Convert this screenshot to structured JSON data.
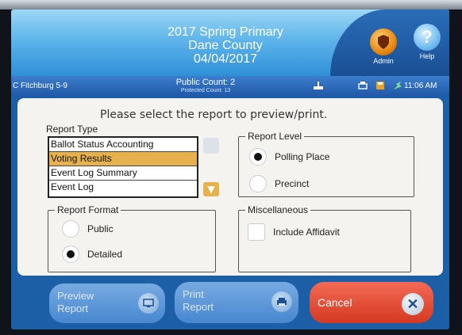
{
  "header": {
    "title_line1": "2017 Spring Primary",
    "title_line2": "Dane County",
    "title_line3": "04/04/2017",
    "admin_label": "Admin",
    "help_label": "Help"
  },
  "statusbar": {
    "precinct": "C Fitchburg 5-9",
    "public_count": "Public Count: 2",
    "protected_count": "Protected Count: 13",
    "time": "11:06 AM"
  },
  "instructions": "Please select the report to preview/print.",
  "report_type": {
    "label": "Report Type",
    "items": [
      "Ballot Status Accounting",
      "Voting Results",
      "Event Log Summary",
      "Event Log"
    ],
    "selected": "Voting Results"
  },
  "report_level": {
    "legend": "Report Level",
    "options": [
      "Polling Place",
      "Precinct"
    ],
    "selected": "Polling Place"
  },
  "report_format": {
    "legend": "Report Format",
    "options": [
      "Public",
      "Detailed"
    ],
    "selected": "Detailed"
  },
  "misc": {
    "legend": "Miscellaneous",
    "include_affidavit": "Include Affidavit"
  },
  "buttons": {
    "preview_line1": "Preview",
    "preview_line2": "Report",
    "print_line1": "Print",
    "print_line2": "Report",
    "cancel": "Cancel"
  },
  "colors": {
    "selected_row": "#e7b24d",
    "cancel": "#d63922",
    "accent_blue": "#1d5fa6"
  }
}
